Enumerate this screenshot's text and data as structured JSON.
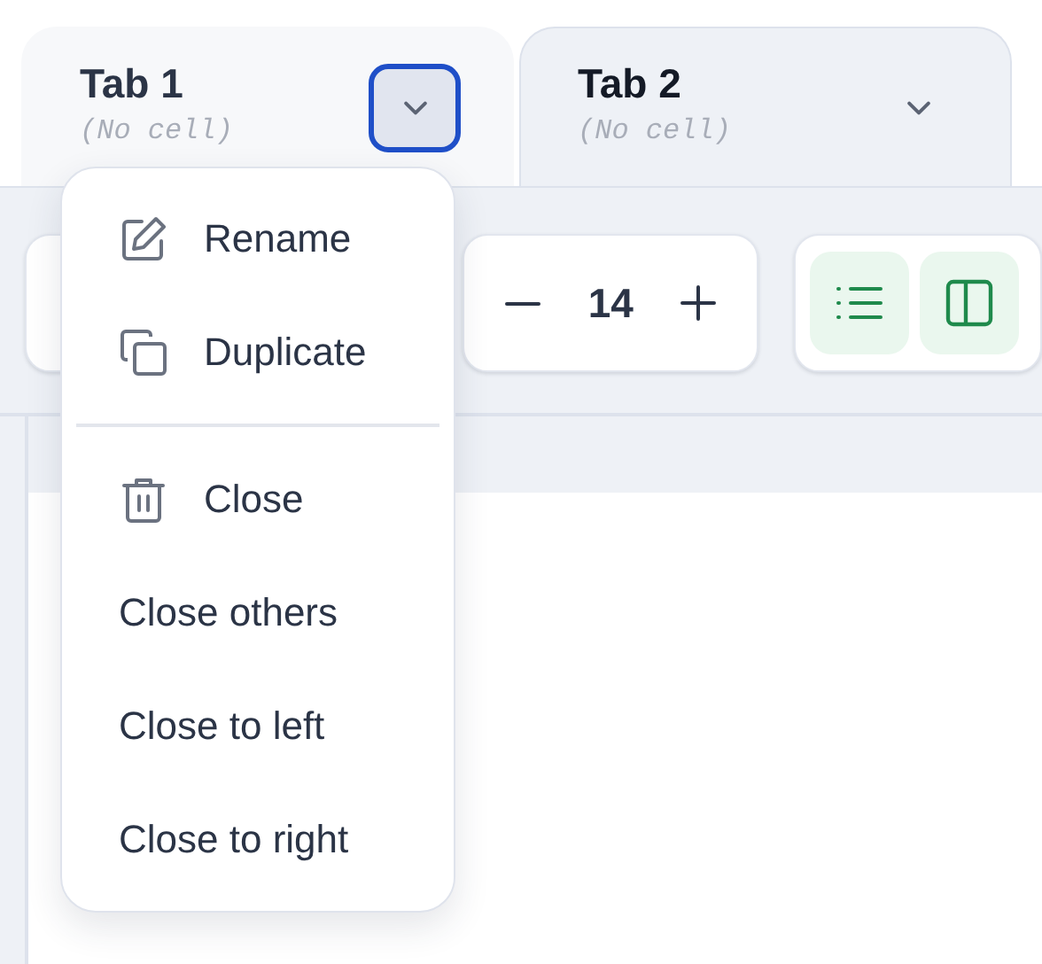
{
  "tabs": [
    {
      "title": "Tab 1",
      "subtitle": "(No cell)",
      "selected": true,
      "menu_open": true
    },
    {
      "title": "Tab 2",
      "subtitle": "(No cell)",
      "selected": false,
      "menu_open": false
    }
  ],
  "font_size": {
    "value": "14"
  },
  "view_buttons": [
    {
      "kind": "list"
    },
    {
      "kind": "columns"
    }
  ],
  "tab_menu": {
    "groups": [
      [
        {
          "label": "Rename",
          "kind": "rename"
        },
        {
          "label": "Duplicate",
          "kind": "duplicate"
        }
      ],
      [
        {
          "label": "Close",
          "kind": "close"
        },
        {
          "label": "Close others",
          "kind": "plain"
        },
        {
          "label": "Close to left",
          "kind": "plain"
        },
        {
          "label": "Close to right",
          "kind": "plain"
        }
      ]
    ]
  }
}
